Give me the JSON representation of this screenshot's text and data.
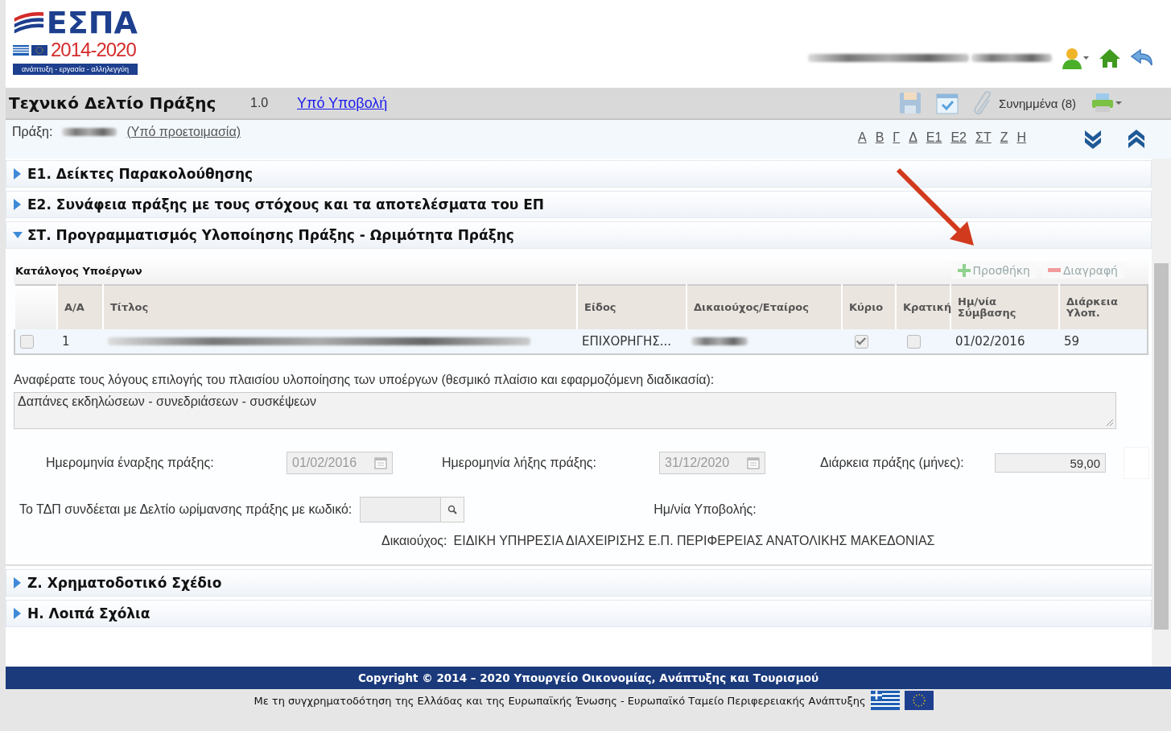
{
  "logo": {
    "name": "ΕΣΠΑ",
    "years": "2014-2020",
    "slogan": "ανάπτυξη - εργασία - αλληλεγγύη"
  },
  "title_bar": {
    "title": "Τεχνικό Δελτίο Πράξης",
    "version": "1.0",
    "status_link": "Υπό Υποβολή",
    "attachments": "Συνημμένα (8)"
  },
  "sub_bar": {
    "label": "Πράξη:",
    "status_link": "(Υπό προετοιμασία)",
    "letters": [
      "Α",
      "Β",
      "Γ",
      "Δ",
      "Ε1",
      "Ε2",
      "ΣΤ",
      "Ζ",
      "Η"
    ]
  },
  "sections": [
    {
      "label": "Ε1. Δείκτες Παρακολούθησης",
      "expanded": false
    },
    {
      "label": "Ε2. Συνάφεια πράξης με τους στόχους και τα αποτελέσματα του ΕΠ",
      "expanded": false
    },
    {
      "label": "ΣΤ. Προγραμματισμός Υλοποίησης Πράξης - Ωριμότητα Πράξης",
      "expanded": true,
      "body": {
        "list_title": "Κατάλογος Υποέργων",
        "add_button": {
          "label": "Προσθήκη",
          "disabled": true
        },
        "delete_button": {
          "label": "Διαγραφή",
          "disabled": true
        },
        "columns": [
          "Α/Α",
          "Τίτλος",
          "Είδος",
          "Δικαιούχος/Εταίρος",
          "Κύριο",
          "Κρατική",
          "Ημ/νία Σύμβασης",
          "Διάρκεια Υλοπ."
        ],
        "rows": [
          {
            "selected": false,
            "number": "1",
            "type": "ΕΠΙΧΟΡΗΓΗΣ...",
            "main": true,
            "state": false,
            "contract_date": "01/02/2016",
            "duration": "59"
          }
        ],
        "reasons_label": "Αναφέρατε τους λόγους επιλογής του πλαισίου υλοποίησης των υποέργων (θεσμικό πλαίσιο και εφαρμοζόμενη διαδικασία):",
        "reasons_value": "Δαπάνες εκδηλώσεων - συνεδριάσεων - συσκέψεων",
        "start_label": "Ημερομηνία έναρξης πράξης:",
        "start_value": "01/02/2016",
        "end_label": "Ημερομηνία λήξης πράξης:",
        "end_value": "31/12/2020",
        "duration_label": "Διάρκεια πράξης (μήνες):",
        "duration_value": "59,00",
        "link_label": "Το ΤΔΠ συνδέεται με Δελτίο ωρίμανσης πράξης με κωδικό:",
        "submission_label": "Ημ/νία Υποβολής:",
        "beneficiary_label": "Δικαιούχος:",
        "beneficiary_value": "ΕΙΔΙΚΗ ΥΠΗΡΕΣΙΑ ΔΙΑΧΕΙΡΙΣΗΣ Ε.Π. ΠΕΡΙΦΕΡΕΙΑΣ ΑΝΑΤΟΛΙΚΗΣ ΜΑΚΕΔΟΝΙΑΣ"
      }
    },
    {
      "label": "Ζ. Χρηματοδοτικό Σχέδιο",
      "expanded": false
    },
    {
      "label": "Η. Λοιπά Σχόλια",
      "expanded": false
    }
  ],
  "footer": {
    "copyright": "Copyright © 2014 – 2020 Υπουργείο Οικονομίας, Ανάπτυξης και Τουρισμού",
    "cofunding": "Με τη συγχρηματοδότηση της Ελλάδας και της Ευρωπαϊκής Ένωσης - Ευρωπαϊκό Ταμείο Περιφερειακής Ανάπτυξης"
  }
}
